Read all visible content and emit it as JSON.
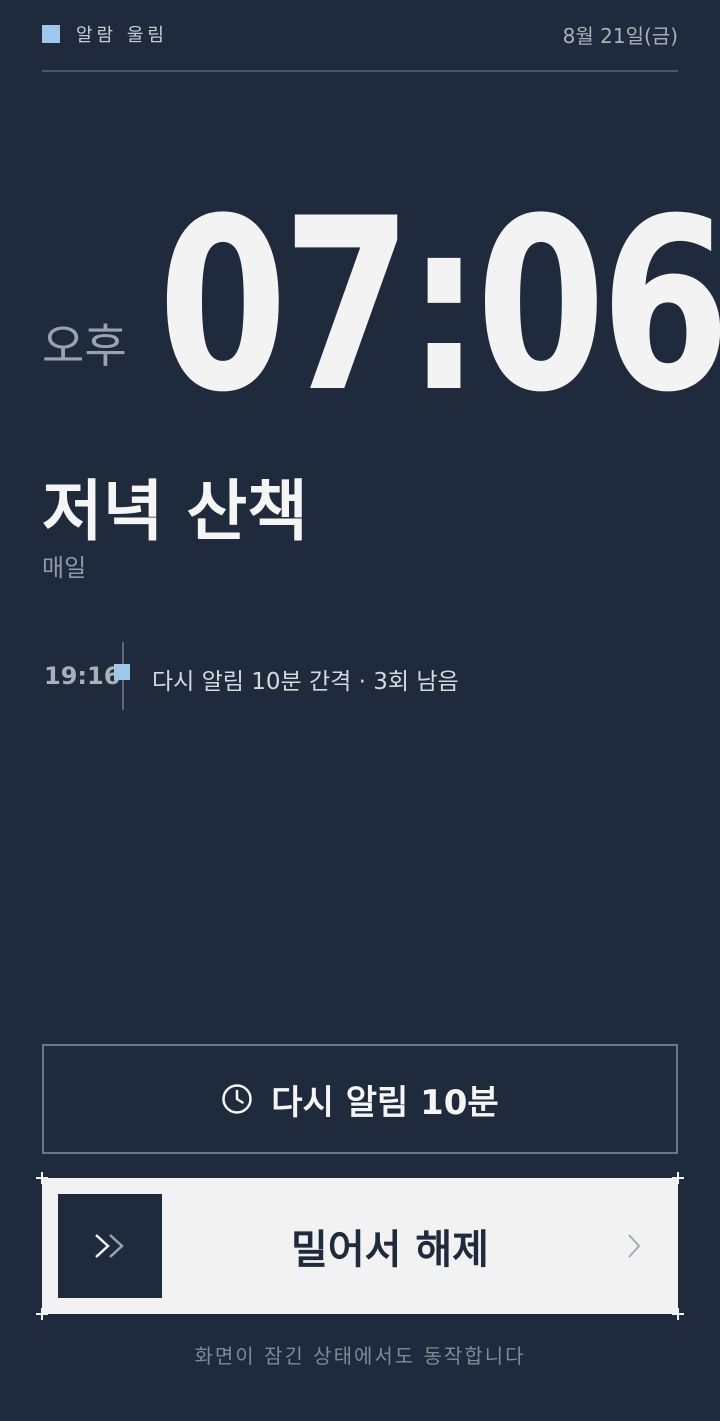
{
  "status": {
    "label": "알람 울림",
    "date": "8월 21일(금)"
  },
  "clock": {
    "ampm": "오후",
    "time": "07:06"
  },
  "alarm": {
    "title": "저녁 산책",
    "repeat": "매일"
  },
  "snooze_info": {
    "time": "19:16",
    "text": "다시 알림 10분 간격 · 3회 남음"
  },
  "snooze_button": {
    "label": "다시 알림 10분",
    "icon": "clock-icon"
  },
  "slide": {
    "label": "밀어서 해제",
    "handle_icon": "double-chevron-right-icon",
    "hint_icon": "chevron-right-icon"
  },
  "footer": {
    "note": "화면이 잠긴 상태에서도 동작합니다"
  },
  "colors": {
    "background": "#1f2b3d",
    "accent": "#9ec7ec",
    "text": "#f2f2f2",
    "muted": "#8f98a4"
  }
}
